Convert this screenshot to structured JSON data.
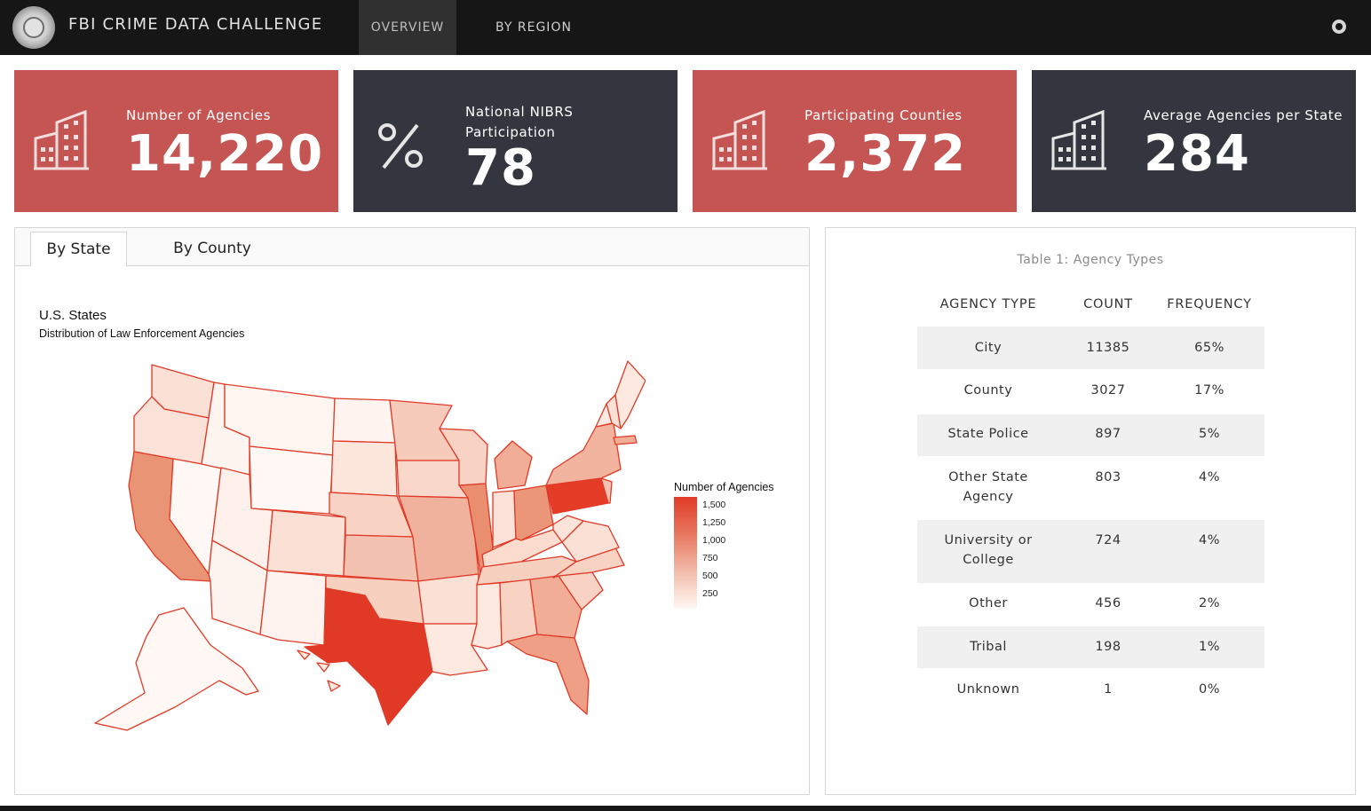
{
  "navbar": {
    "brand": "FBI CRIME DATA CHALLENGE",
    "tabs": [
      {
        "label": "OVERVIEW",
        "active": true
      },
      {
        "label": "BY REGION",
        "active": false
      }
    ],
    "github_icon": "github-icon"
  },
  "value_boxes": [
    {
      "label": "Number of Agencies",
      "value": "14,220",
      "icon": "building-icon",
      "color": "#c55553"
    },
    {
      "label": "National NIBRS Participation",
      "value": "78",
      "icon": "percent-icon",
      "color": "#33363e"
    },
    {
      "label": "Participating Counties",
      "value": "2,372",
      "icon": "building-icon",
      "color": "#c55553"
    },
    {
      "label": "Average Agencies per State",
      "value": "284",
      "icon": "building-icon",
      "color": "#33363e"
    }
  ],
  "map_panel": {
    "tabs": [
      {
        "label": "By State",
        "active": true
      },
      {
        "label": "By County",
        "active": false
      }
    ],
    "title": "U.S. States",
    "subtitle": "Distribution of Law Enforcement Agencies",
    "legend": {
      "title": "Number of Agencies",
      "ticks": [
        "1,500",
        "1,250",
        "1,000",
        "750",
        "500",
        "250"
      ]
    },
    "colors": {
      "high": "#e03a27",
      "low": "#fff7f3",
      "border": "#e03a27"
    }
  },
  "agency_table": {
    "caption": "Table 1: Agency Types",
    "headers": [
      "AGENCY TYPE",
      "COUNT",
      "FREQUENCY"
    ],
    "rows": [
      {
        "type": "City",
        "count": "11385",
        "frequency": "65%"
      },
      {
        "type": "County",
        "count": "3027",
        "frequency": "17%"
      },
      {
        "type": "State Police",
        "count": "897",
        "frequency": "5%"
      },
      {
        "type": "Other State Agency",
        "count": "803",
        "frequency": "4%"
      },
      {
        "type": "University or College",
        "count": "724",
        "frequency": "4%"
      },
      {
        "type": "Other",
        "count": "456",
        "frequency": "2%"
      },
      {
        "type": "Tribal",
        "count": "198",
        "frequency": "1%"
      },
      {
        "type": "Unknown",
        "count": "1",
        "frequency": "0%"
      }
    ]
  }
}
